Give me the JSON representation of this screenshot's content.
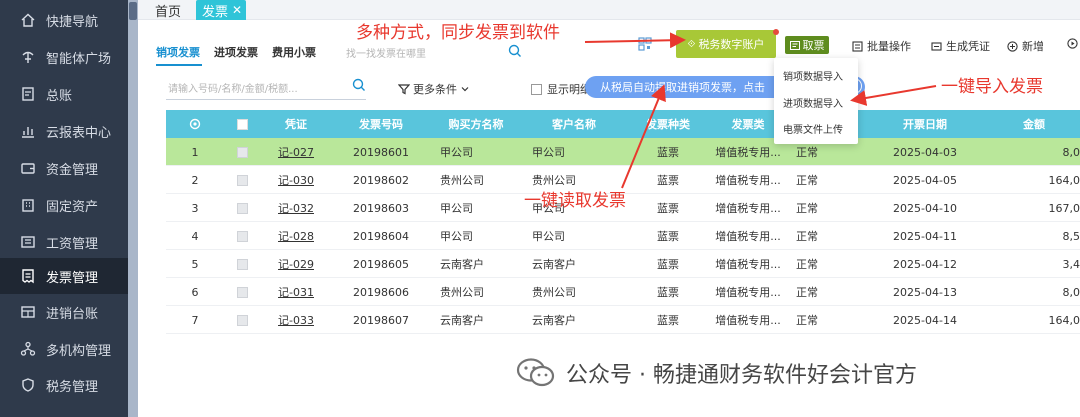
{
  "sidebar": {
    "items": [
      {
        "label": "快捷导航",
        "icon": "home-icon"
      },
      {
        "label": "智能体广场",
        "icon": "agent-icon"
      },
      {
        "label": "总账",
        "icon": "ledger-icon"
      },
      {
        "label": "云报表中心",
        "icon": "chart-icon"
      },
      {
        "label": "资金管理",
        "icon": "wallet-icon"
      },
      {
        "label": "固定资产",
        "icon": "building-icon"
      },
      {
        "label": "工资管理",
        "icon": "payroll-icon"
      },
      {
        "label": "发票管理",
        "icon": "invoice-icon"
      },
      {
        "label": "进销台账",
        "icon": "inventory-icon"
      },
      {
        "label": "多机构管理",
        "icon": "org-icon"
      },
      {
        "label": "税务管理",
        "icon": "tax-icon"
      }
    ]
  },
  "tabs": {
    "home": "首页",
    "invoice": "发票",
    "close": "✕"
  },
  "subtabs": {
    "sales": "销项发票",
    "purchase": "进项发票",
    "expense": "费用小票"
  },
  "search": {
    "top_placeholder": "找一找发票在哪里",
    "main_placeholder": "请输入号码/名称/金额/税额..."
  },
  "filters": {
    "more": "更多条件",
    "show_detail": "显示明细"
  },
  "tooltip": {
    "text": "从税局自动提取进销项发票，点击"
  },
  "toolbar": {
    "tax_account": "税务数字账户",
    "fetch": "取票",
    "batch": "批量操作",
    "voucher": "生成凭证",
    "add": "新增"
  },
  "dropdown": {
    "items": [
      "销项数据导入",
      "进项数据导入",
      "电票文件上传"
    ]
  },
  "table": {
    "headers": [
      "",
      "凭证",
      "发票号码",
      "购买方名称",
      "客户名称",
      "发票种类",
      "发票类",
      "态",
      "开票日期",
      "金额"
    ],
    "rows": [
      {
        "idx": "1",
        "voucher": "记-027",
        "number": "20198601",
        "buyer": "甲公司",
        "customer": "甲公司",
        "kind": "蓝票",
        "type": "增值税专用...",
        "status": "正常",
        "date": "2025-04-03",
        "amount": "8,0"
      },
      {
        "idx": "2",
        "voucher": "记-030",
        "number": "20198602",
        "buyer": "贵州公司",
        "customer": "贵州公司",
        "kind": "蓝票",
        "type": "增值税专用...",
        "status": "正常",
        "date": "2025-04-05",
        "amount": "164,0"
      },
      {
        "idx": "3",
        "voucher": "记-032",
        "number": "20198603",
        "buyer": "甲公司",
        "customer": "甲公司",
        "kind": "蓝票",
        "type": "增值税专用...",
        "status": "正常",
        "date": "2025-04-10",
        "amount": "167,0"
      },
      {
        "idx": "4",
        "voucher": "记-028",
        "number": "20198604",
        "buyer": "甲公司",
        "customer": "甲公司",
        "kind": "蓝票",
        "type": "增值税专用...",
        "status": "正常",
        "date": "2025-04-11",
        "amount": "8,5"
      },
      {
        "idx": "5",
        "voucher": "记-029",
        "number": "20198605",
        "buyer": "云南客户",
        "customer": "云南客户",
        "kind": "蓝票",
        "type": "增值税专用...",
        "status": "正常",
        "date": "2025-04-12",
        "amount": "3,4"
      },
      {
        "idx": "6",
        "voucher": "记-031",
        "number": "20198606",
        "buyer": "贵州公司",
        "customer": "贵州公司",
        "kind": "蓝票",
        "type": "增值税专用...",
        "status": "正常",
        "date": "2025-04-13",
        "amount": "8,0"
      },
      {
        "idx": "7",
        "voucher": "记-033",
        "number": "20198607",
        "buyer": "云南客户",
        "customer": "云南客户",
        "kind": "蓝票",
        "type": "增值税专用...",
        "status": "正常",
        "date": "2025-04-14",
        "amount": "164,0"
      }
    ]
  },
  "annotations": {
    "sync": "多种方式，同步发票到软件",
    "import": "一键导入发票",
    "read": "一键读取发票"
  },
  "watermark": "公众号 · 畅捷通财务软件好会计官方",
  "colors": {
    "accent": "#59c5dc",
    "highlight_row": "#b9e79a",
    "annotation": "#e8382e",
    "sidebar": "#2f3a4b"
  }
}
